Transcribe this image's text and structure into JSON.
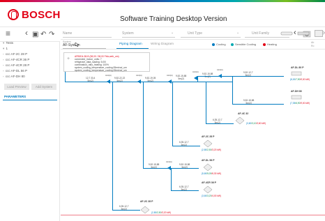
{
  "brand": {
    "logo_text": "BOSCH",
    "accent": "#e20015",
    "pipe_color": "#007bc0"
  },
  "app": {
    "title": "Software Training   Desktop Version"
  },
  "toolbar": {
    "menu_icon": "≡",
    "back_icon": "‹",
    "fwd_icon": "›",
    "save_icon": "▣",
    "undo_icon": "↶",
    "redo_icon": "↷"
  },
  "sidebar": {
    "tree": [
      {
        "prefix": "▾ ",
        "label": "Tests"
      },
      {
        "prefix": "  ▾ ",
        "label": "1"
      },
      {
        "prefix": "    ▫ ",
        "label": "ccc AF-2C 28 P"
      },
      {
        "prefix": "    ▫ ",
        "label": "ccc AF-4CR 36 P"
      },
      {
        "prefix": "    ▫ ",
        "label": "ccc AF-4CR 28 P"
      },
      {
        "prefix": "    ▫ ",
        "label": "ccc AF-DL 56 P"
      },
      {
        "prefix": "    ▫ ",
        "label": "ccc AF-DH 80"
      }
    ],
    "btn_left": "Load Preview",
    "btn_right": "Add System",
    "tab_label": "PARAMETERS"
  },
  "filters": {
    "name": "Name",
    "system": "System",
    "unit_type": "Unit Type",
    "unit_family": "Unit Family",
    "caret": "⌄",
    "nav_left": "‹",
    "right_label": "Ab",
    "right_label2": "Ro"
  },
  "tabs": {
    "system_label": "System",
    "system_value": "AF-System",
    "piping": "Piping Diagram",
    "wiring": "Wiring Diagram",
    "legend": [
      {
        "label": "Cooling",
        "color": "#007bc0"
      },
      {
        "label": "Sensible Cooling",
        "color": "#00a8b0"
      },
      {
        "label": "Heating",
        "color": "#e20015"
      }
    ]
  },
  "outdoor": {
    "line1": "AFB3D4-38-B (38,00 / 38,00 Fritz,web_um)",
    "line2": "connected_indoor_units: 7",
    "line3": "refrigerant_data_loading: 5,00l",
    "line4": "combination_ratio_heating: 100%",
    "line5": "system_cooling_temperature_cooling:35extrod_um",
    "line6": "system_cooling_temperature_cooling:35extrod_um"
  },
  "pipes": {
    "main": {
      "len": "12,7 33,4",
      "dim": "5m(2)"
    },
    "b1": {
      "len": "9,52-22,22",
      "dim": "5m(2)"
    },
    "b2": {
      "len": "9,52-19,05",
      "dim": "5m(2)"
    },
    "b3": {
      "len": "9,52-15,88",
      "dim": "5m(2)"
    },
    "b4": {
      "len": "9,52-15,88",
      "dim": "5m(2)"
    },
    "b5": {
      "len": "9,52-12,7",
      "dim": "5m(2)"
    },
    "d_dl56": {
      "len": "6,35-12,7",
      "dim": "5m(2)"
    },
    "d_dh80": {
      "len": "9,52-15,88",
      "dim": "5m(2)"
    },
    "d_4c32": {
      "len": "6,35-12,7",
      "dim": "5m(2)"
    },
    "d_2c28": {
      "len": "6,35-12,7",
      "dim": "5m(2)"
    },
    "d_b3": {
      "len": "9,52-15,88",
      "dim": "5m(2)"
    },
    "d_dl56b": {
      "len": "9,52-15,88",
      "dim": "5m(2)"
    },
    "d_4cr36": {
      "len": "6,35-12,7",
      "dim": "5m(2)"
    },
    "d_2c28b": {
      "len": "6,35-12,7",
      "dim": "5m(2)"
    },
    "joint_label": "Joint(A)"
  },
  "units": {
    "u1": {
      "name": "AF-DL 80 P",
      "cool": "(8,00",
      "sens": "/7,90",
      "heat": "/9,00 kW)"
    },
    "u2": {
      "name": "AF-DH 80",
      "cool": "(7,05",
      "sens": "/6,90",
      "heat": "/9,00 kW)"
    },
    "u3": {
      "name": "AF-4C 32",
      "cool": "(3,60",
      "sens": "/3,10",
      "heat": "/3,60 kW)"
    },
    "u4": {
      "name": "AF-2C 28 P",
      "cool": "(2,80",
      "sens": "/2,50",
      "heat": "/3,20 kW)"
    },
    "u5": {
      "name": "AF-DL 56 P",
      "cool": "(5,60",
      "sens": "/5,00",
      "heat": "/6,30 kW)"
    },
    "u6": {
      "name": "AF-4CR 36 P",
      "cool": "(3,60",
      "sens": "/3,20",
      "heat": "/4,00 kW)"
    },
    "u7": {
      "name": "AF-2C 28 P",
      "cool": "(2,80",
      "sens": "/2,50",
      "heat": "/3,20 kW)"
    }
  }
}
